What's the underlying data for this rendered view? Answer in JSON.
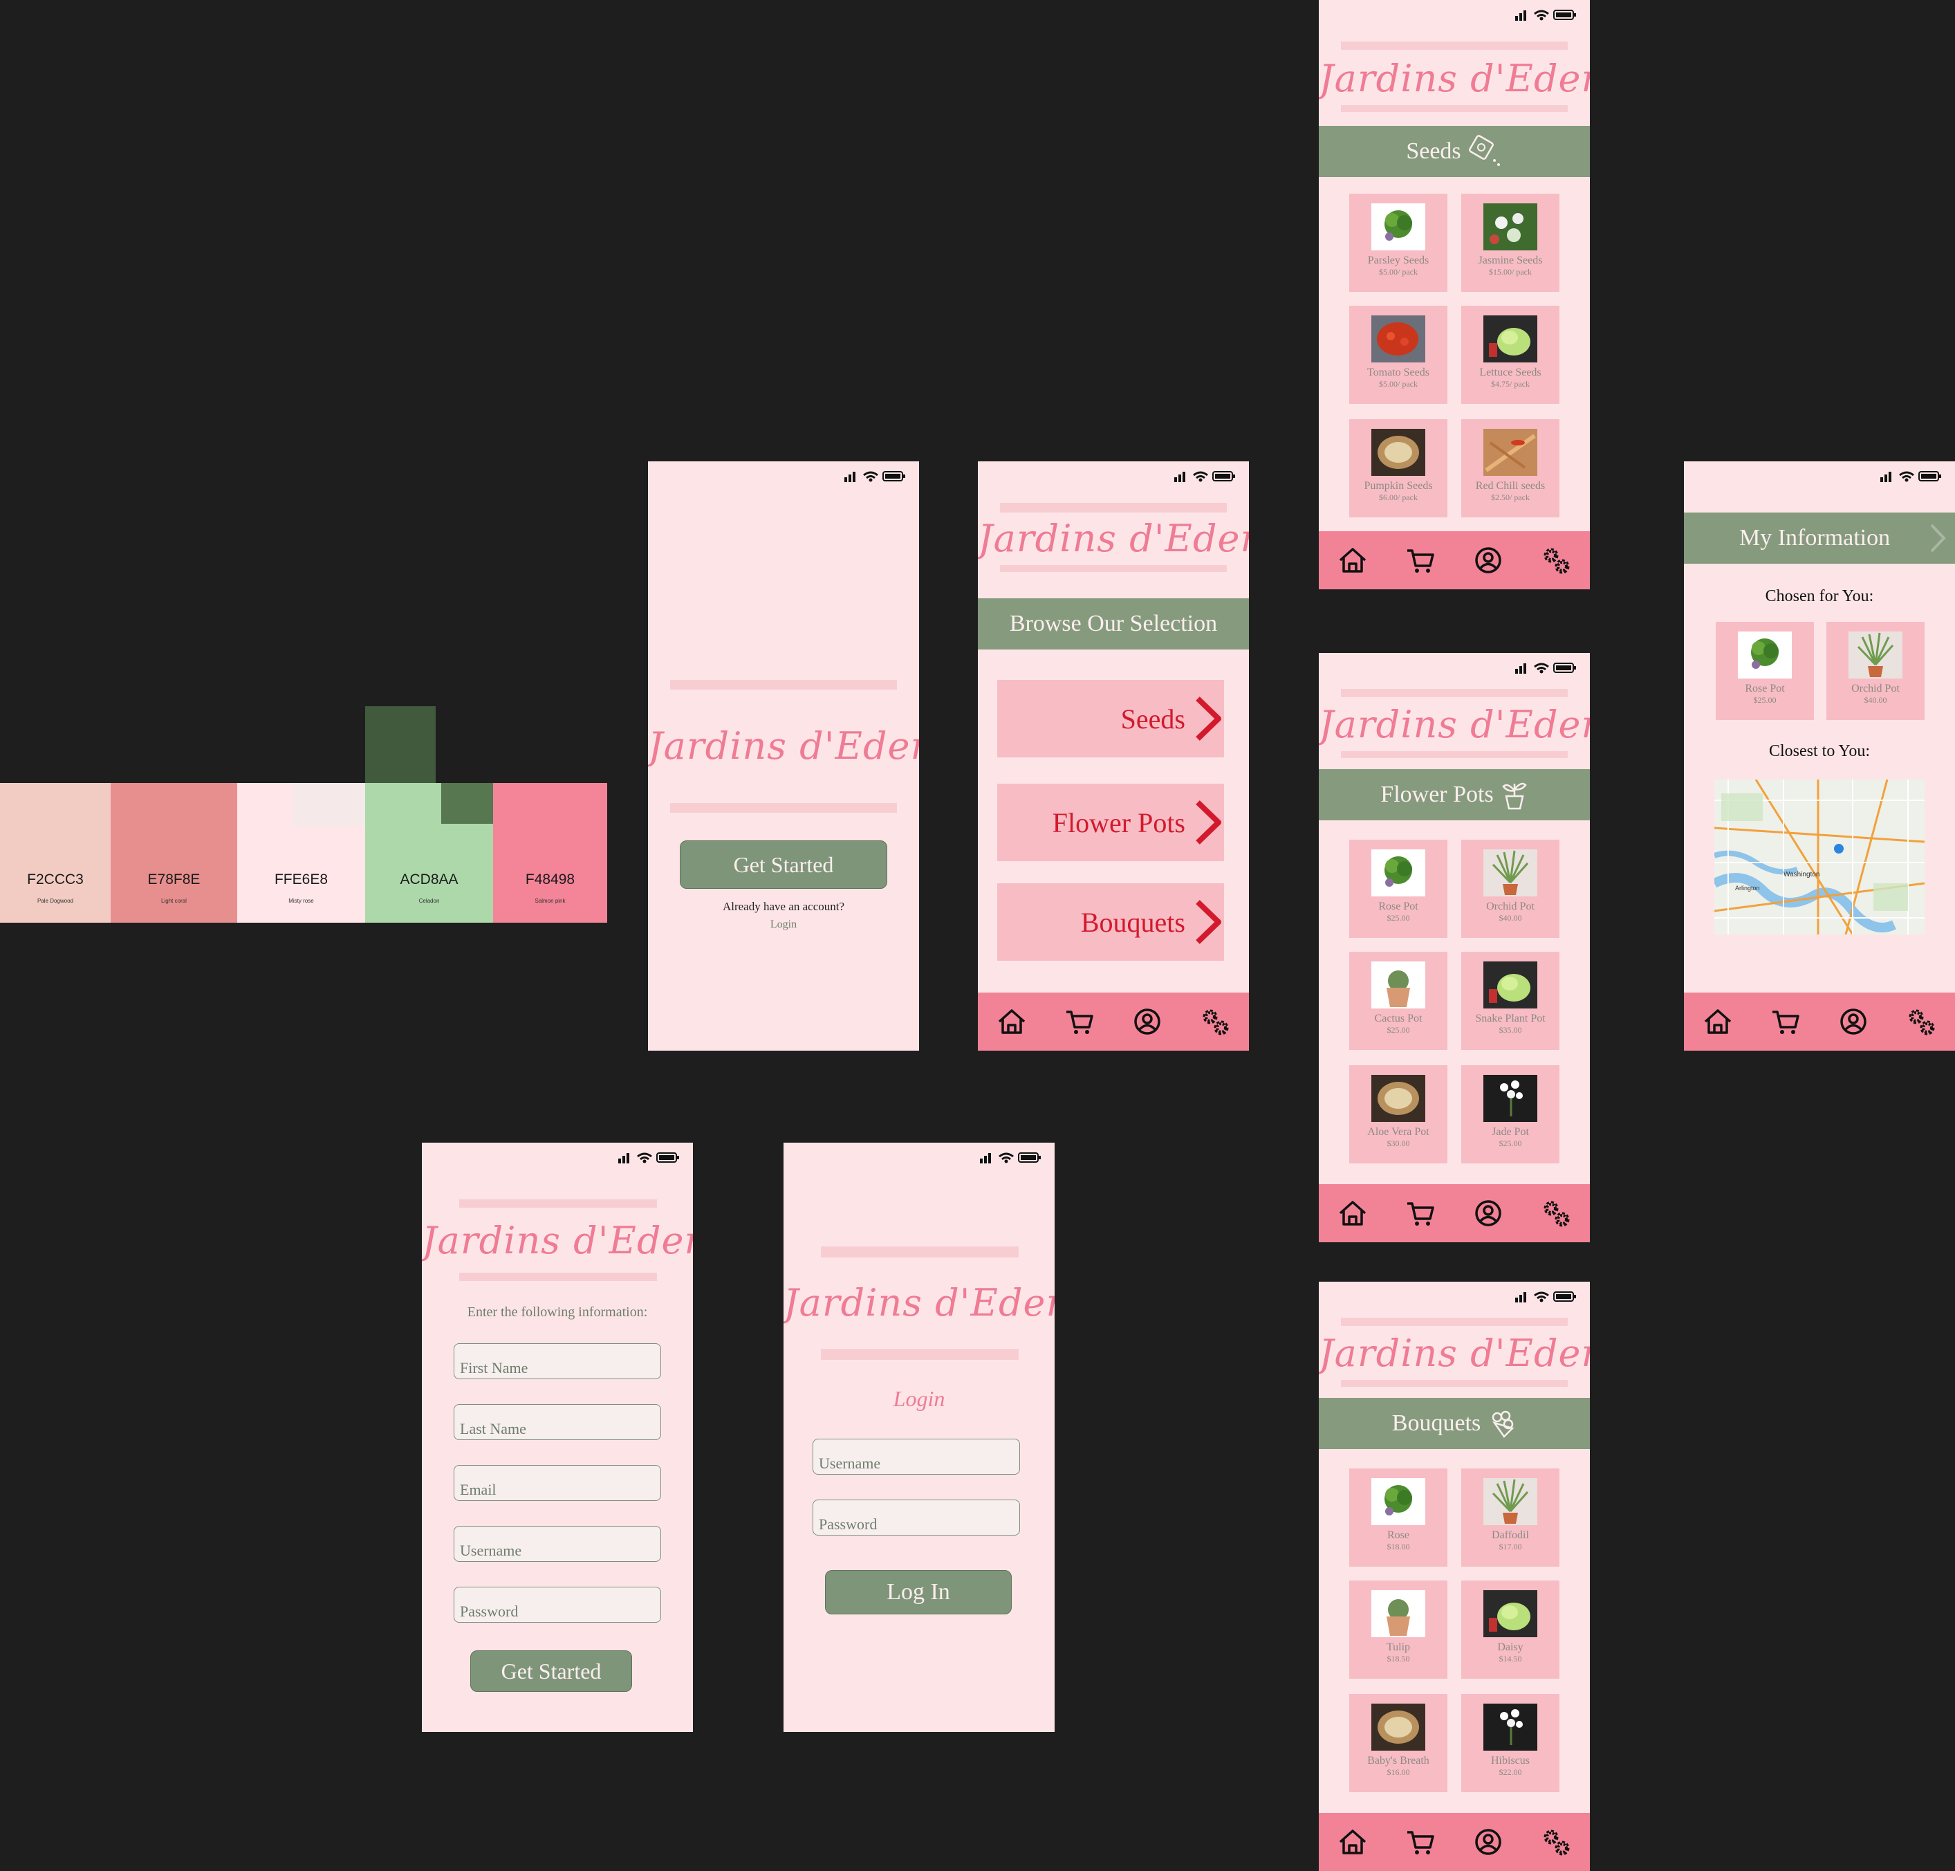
{
  "brand": "Jardins d'Eden",
  "palette": [
    {
      "code": "F2CCC3",
      "name": "Pale Dogwood",
      "color": "#F2CCC3"
    },
    {
      "code": "E78F8E",
      "name": "Light coral",
      "color": "#E78F8E"
    },
    {
      "code": "FFE6E8",
      "name": "Misty rose",
      "color": "#FFE6E8"
    },
    {
      "code": "ACD8AA",
      "name": "Celadon",
      "color": "#ACD8AA"
    },
    {
      "code": "F48498",
      "name": "Salmon pink",
      "color": "#F48498"
    }
  ],
  "welcome": {
    "cta": "Get Started",
    "prompt": "Already have an account?",
    "login_link": "Login"
  },
  "browse": {
    "header": "Browse Our Selection",
    "categories": [
      "Seeds",
      "Flower Pots",
      "Bouquets"
    ]
  },
  "seeds": {
    "header": "Seeds",
    "items": [
      {
        "name": "Parsley Seeds",
        "price": "$5.00/ pack"
      },
      {
        "name": "Jasmine Seeds",
        "price": "$15.00/ pack"
      },
      {
        "name": "Tomato Seeds",
        "price": "$5.00/ pack"
      },
      {
        "name": "Lettuce Seeds",
        "price": "$4.75/ pack"
      },
      {
        "name": "Pumpkin Seeds",
        "price": "$6.00/ pack"
      },
      {
        "name": "Red Chili seeds",
        "price": "$2.50/ pack"
      }
    ]
  },
  "flowerpots": {
    "header": "Flower Pots",
    "items": [
      {
        "name": "Rose Pot",
        "price": "$25.00"
      },
      {
        "name": "Orchid Pot",
        "price": "$40.00"
      },
      {
        "name": "Cactus Pot",
        "price": "$25.00"
      },
      {
        "name": "Snake Plant Pot",
        "price": "$35.00"
      },
      {
        "name": "Aloe Vera Pot",
        "price": "$30.00"
      },
      {
        "name": "Jade Pot",
        "price": "$25.00"
      }
    ]
  },
  "bouquets": {
    "header": "Bouquets",
    "items": [
      {
        "name": "Rose",
        "price": "$18.00"
      },
      {
        "name": "Daffodil",
        "price": "$17.00"
      },
      {
        "name": "Tulip",
        "price": "$18.50"
      },
      {
        "name": "Daisy",
        "price": "$14.50"
      },
      {
        "name": "Baby's Breath",
        "price": "$16.00"
      },
      {
        "name": "Hibiscus",
        "price": "$22.00"
      }
    ]
  },
  "myinfo": {
    "header": "My Information",
    "chosen": "Chosen for You:",
    "closest": "Closest to You:",
    "items": [
      {
        "name": "Rose Pot",
        "price": "$25.00"
      },
      {
        "name": "Orchid Pot",
        "price": "$40.00"
      }
    ],
    "map_labels": [
      "Washington",
      "Arlington"
    ]
  },
  "signup": {
    "prompt": "Enter the following information:",
    "fields": [
      "First Name",
      "Last Name",
      "Email",
      "Username",
      "Password"
    ],
    "cta": "Get Started"
  },
  "login": {
    "title": "Login",
    "fields": [
      "Username",
      "Password"
    ],
    "cta": "Log In"
  }
}
